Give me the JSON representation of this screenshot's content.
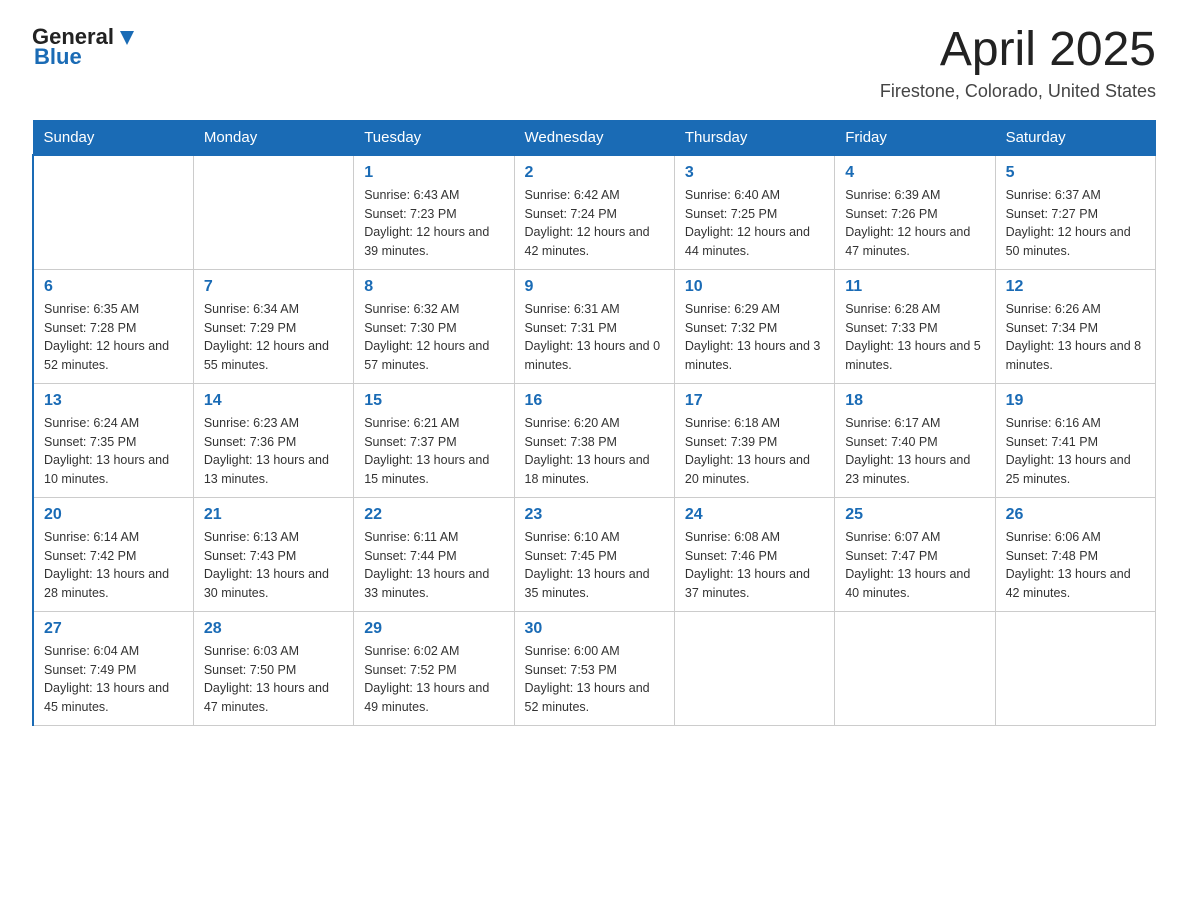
{
  "header": {
    "logo_general": "General",
    "logo_blue": "Blue",
    "month_title": "April 2025",
    "location": "Firestone, Colorado, United States"
  },
  "days_of_week": [
    "Sunday",
    "Monday",
    "Tuesday",
    "Wednesday",
    "Thursday",
    "Friday",
    "Saturday"
  ],
  "weeks": [
    [
      {
        "day": "",
        "sunrise": "",
        "sunset": "",
        "daylight": ""
      },
      {
        "day": "",
        "sunrise": "",
        "sunset": "",
        "daylight": ""
      },
      {
        "day": "1",
        "sunrise": "Sunrise: 6:43 AM",
        "sunset": "Sunset: 7:23 PM",
        "daylight": "Daylight: 12 hours and 39 minutes."
      },
      {
        "day": "2",
        "sunrise": "Sunrise: 6:42 AM",
        "sunset": "Sunset: 7:24 PM",
        "daylight": "Daylight: 12 hours and 42 minutes."
      },
      {
        "day": "3",
        "sunrise": "Sunrise: 6:40 AM",
        "sunset": "Sunset: 7:25 PM",
        "daylight": "Daylight: 12 hours and 44 minutes."
      },
      {
        "day": "4",
        "sunrise": "Sunrise: 6:39 AM",
        "sunset": "Sunset: 7:26 PM",
        "daylight": "Daylight: 12 hours and 47 minutes."
      },
      {
        "day": "5",
        "sunrise": "Sunrise: 6:37 AM",
        "sunset": "Sunset: 7:27 PM",
        "daylight": "Daylight: 12 hours and 50 minutes."
      }
    ],
    [
      {
        "day": "6",
        "sunrise": "Sunrise: 6:35 AM",
        "sunset": "Sunset: 7:28 PM",
        "daylight": "Daylight: 12 hours and 52 minutes."
      },
      {
        "day": "7",
        "sunrise": "Sunrise: 6:34 AM",
        "sunset": "Sunset: 7:29 PM",
        "daylight": "Daylight: 12 hours and 55 minutes."
      },
      {
        "day": "8",
        "sunrise": "Sunrise: 6:32 AM",
        "sunset": "Sunset: 7:30 PM",
        "daylight": "Daylight: 12 hours and 57 minutes."
      },
      {
        "day": "9",
        "sunrise": "Sunrise: 6:31 AM",
        "sunset": "Sunset: 7:31 PM",
        "daylight": "Daylight: 13 hours and 0 minutes."
      },
      {
        "day": "10",
        "sunrise": "Sunrise: 6:29 AM",
        "sunset": "Sunset: 7:32 PM",
        "daylight": "Daylight: 13 hours and 3 minutes."
      },
      {
        "day": "11",
        "sunrise": "Sunrise: 6:28 AM",
        "sunset": "Sunset: 7:33 PM",
        "daylight": "Daylight: 13 hours and 5 minutes."
      },
      {
        "day": "12",
        "sunrise": "Sunrise: 6:26 AM",
        "sunset": "Sunset: 7:34 PM",
        "daylight": "Daylight: 13 hours and 8 minutes."
      }
    ],
    [
      {
        "day": "13",
        "sunrise": "Sunrise: 6:24 AM",
        "sunset": "Sunset: 7:35 PM",
        "daylight": "Daylight: 13 hours and 10 minutes."
      },
      {
        "day": "14",
        "sunrise": "Sunrise: 6:23 AM",
        "sunset": "Sunset: 7:36 PM",
        "daylight": "Daylight: 13 hours and 13 minutes."
      },
      {
        "day": "15",
        "sunrise": "Sunrise: 6:21 AM",
        "sunset": "Sunset: 7:37 PM",
        "daylight": "Daylight: 13 hours and 15 minutes."
      },
      {
        "day": "16",
        "sunrise": "Sunrise: 6:20 AM",
        "sunset": "Sunset: 7:38 PM",
        "daylight": "Daylight: 13 hours and 18 minutes."
      },
      {
        "day": "17",
        "sunrise": "Sunrise: 6:18 AM",
        "sunset": "Sunset: 7:39 PM",
        "daylight": "Daylight: 13 hours and 20 minutes."
      },
      {
        "day": "18",
        "sunrise": "Sunrise: 6:17 AM",
        "sunset": "Sunset: 7:40 PM",
        "daylight": "Daylight: 13 hours and 23 minutes."
      },
      {
        "day": "19",
        "sunrise": "Sunrise: 6:16 AM",
        "sunset": "Sunset: 7:41 PM",
        "daylight": "Daylight: 13 hours and 25 minutes."
      }
    ],
    [
      {
        "day": "20",
        "sunrise": "Sunrise: 6:14 AM",
        "sunset": "Sunset: 7:42 PM",
        "daylight": "Daylight: 13 hours and 28 minutes."
      },
      {
        "day": "21",
        "sunrise": "Sunrise: 6:13 AM",
        "sunset": "Sunset: 7:43 PM",
        "daylight": "Daylight: 13 hours and 30 minutes."
      },
      {
        "day": "22",
        "sunrise": "Sunrise: 6:11 AM",
        "sunset": "Sunset: 7:44 PM",
        "daylight": "Daylight: 13 hours and 33 minutes."
      },
      {
        "day": "23",
        "sunrise": "Sunrise: 6:10 AM",
        "sunset": "Sunset: 7:45 PM",
        "daylight": "Daylight: 13 hours and 35 minutes."
      },
      {
        "day": "24",
        "sunrise": "Sunrise: 6:08 AM",
        "sunset": "Sunset: 7:46 PM",
        "daylight": "Daylight: 13 hours and 37 minutes."
      },
      {
        "day": "25",
        "sunrise": "Sunrise: 6:07 AM",
        "sunset": "Sunset: 7:47 PM",
        "daylight": "Daylight: 13 hours and 40 minutes."
      },
      {
        "day": "26",
        "sunrise": "Sunrise: 6:06 AM",
        "sunset": "Sunset: 7:48 PM",
        "daylight": "Daylight: 13 hours and 42 minutes."
      }
    ],
    [
      {
        "day": "27",
        "sunrise": "Sunrise: 6:04 AM",
        "sunset": "Sunset: 7:49 PM",
        "daylight": "Daylight: 13 hours and 45 minutes."
      },
      {
        "day": "28",
        "sunrise": "Sunrise: 6:03 AM",
        "sunset": "Sunset: 7:50 PM",
        "daylight": "Daylight: 13 hours and 47 minutes."
      },
      {
        "day": "29",
        "sunrise": "Sunrise: 6:02 AM",
        "sunset": "Sunset: 7:52 PM",
        "daylight": "Daylight: 13 hours and 49 minutes."
      },
      {
        "day": "30",
        "sunrise": "Sunrise: 6:00 AM",
        "sunset": "Sunset: 7:53 PM",
        "daylight": "Daylight: 13 hours and 52 minutes."
      },
      {
        "day": "",
        "sunrise": "",
        "sunset": "",
        "daylight": ""
      },
      {
        "day": "",
        "sunrise": "",
        "sunset": "",
        "daylight": ""
      },
      {
        "day": "",
        "sunrise": "",
        "sunset": "",
        "daylight": ""
      }
    ]
  ]
}
